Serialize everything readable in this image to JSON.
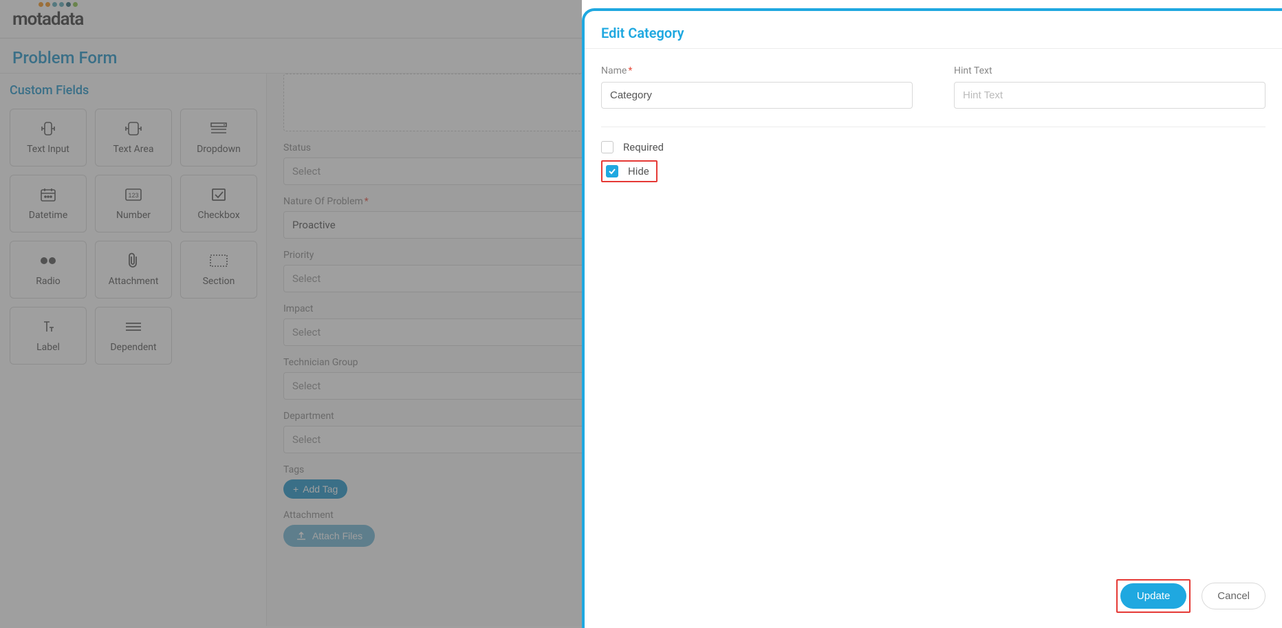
{
  "brand": "motadata",
  "page_title": "Problem Form",
  "sidebar": {
    "title": "Custom Fields",
    "items": [
      {
        "label": "Text Input",
        "icon": "text-input-icon"
      },
      {
        "label": "Text Area",
        "icon": "text-area-icon"
      },
      {
        "label": "Dropdown",
        "icon": "dropdown-icon"
      },
      {
        "label": "Datetime",
        "icon": "datetime-icon"
      },
      {
        "label": "Number",
        "icon": "number-icon"
      },
      {
        "label": "Checkbox",
        "icon": "checkbox-icon"
      },
      {
        "label": "Radio",
        "icon": "radio-icon"
      },
      {
        "label": "Attachment",
        "icon": "attachment-icon"
      },
      {
        "label": "Section",
        "icon": "section-icon"
      },
      {
        "label": "Label",
        "icon": "label-icon"
      },
      {
        "label": "Dependent",
        "icon": "dependent-icon"
      }
    ]
  },
  "form": {
    "status": {
      "label": "Status",
      "value": "Select"
    },
    "nature": {
      "label": "Nature Of Problem",
      "required": true,
      "value": "Proactive"
    },
    "priority": {
      "label": "Priority",
      "value": "Select"
    },
    "impact": {
      "label": "Impact",
      "value": "Select"
    },
    "tech_group": {
      "label": "Technician Group",
      "value": "Select"
    },
    "department": {
      "label": "Department",
      "value": "Select"
    },
    "tags": {
      "label": "Tags",
      "button": "Add Tag"
    },
    "attachment": {
      "label": "Attachment",
      "button": "Attach Files"
    }
  },
  "panel": {
    "title": "Edit Category",
    "name_label": "Name",
    "name_value": "Category",
    "hint_label": "Hint Text",
    "hint_placeholder": "Hint Text",
    "required_label": "Required",
    "required_checked": false,
    "hide_label": "Hide",
    "hide_checked": true,
    "update_btn": "Update",
    "cancel_btn": "Cancel"
  }
}
